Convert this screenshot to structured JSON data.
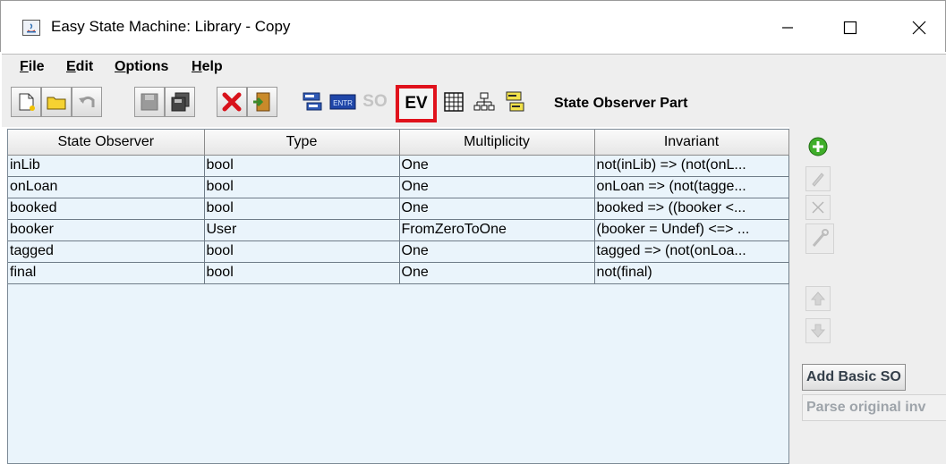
{
  "window": {
    "title": "Easy State Machine: Library - Copy"
  },
  "menu": [
    {
      "label": "File",
      "mnemonic": "F",
      "rest": "ile"
    },
    {
      "label": "Edit",
      "mnemonic": "E",
      "rest": "dit"
    },
    {
      "label": "Options",
      "mnemonic": "O",
      "rest": "ptions"
    },
    {
      "label": "Help",
      "mnemonic": "H",
      "rest": "elp"
    }
  ],
  "toolbar": {
    "ev_label": "EV",
    "so_label": "SO",
    "entity_label": "ENTR",
    "part_label": "State Observer Part",
    "highlight_color": "#e0121c"
  },
  "table": {
    "columns": [
      "State Observer",
      "Type",
      "Multiplicity",
      "Invariant"
    ],
    "rows": [
      [
        "inLib",
        "bool",
        "One",
        "not(inLib) => (not(onL..."
      ],
      [
        "onLoan",
        "bool",
        "One",
        "onLoan => (not(tagge..."
      ],
      [
        "booked",
        "bool",
        "One",
        "booked => ((booker <..."
      ],
      [
        "booker",
        "User",
        "FromZeroToOne",
        "(booker = Undef) <=> ..."
      ],
      [
        "tagged",
        "bool",
        "One",
        "tagged => (not(onLoa..."
      ],
      [
        "final",
        "bool",
        "One",
        "not(final)"
      ]
    ]
  },
  "side": {
    "add_basic_label": "Add Basic SO",
    "parse_label": "Parse original inv"
  }
}
